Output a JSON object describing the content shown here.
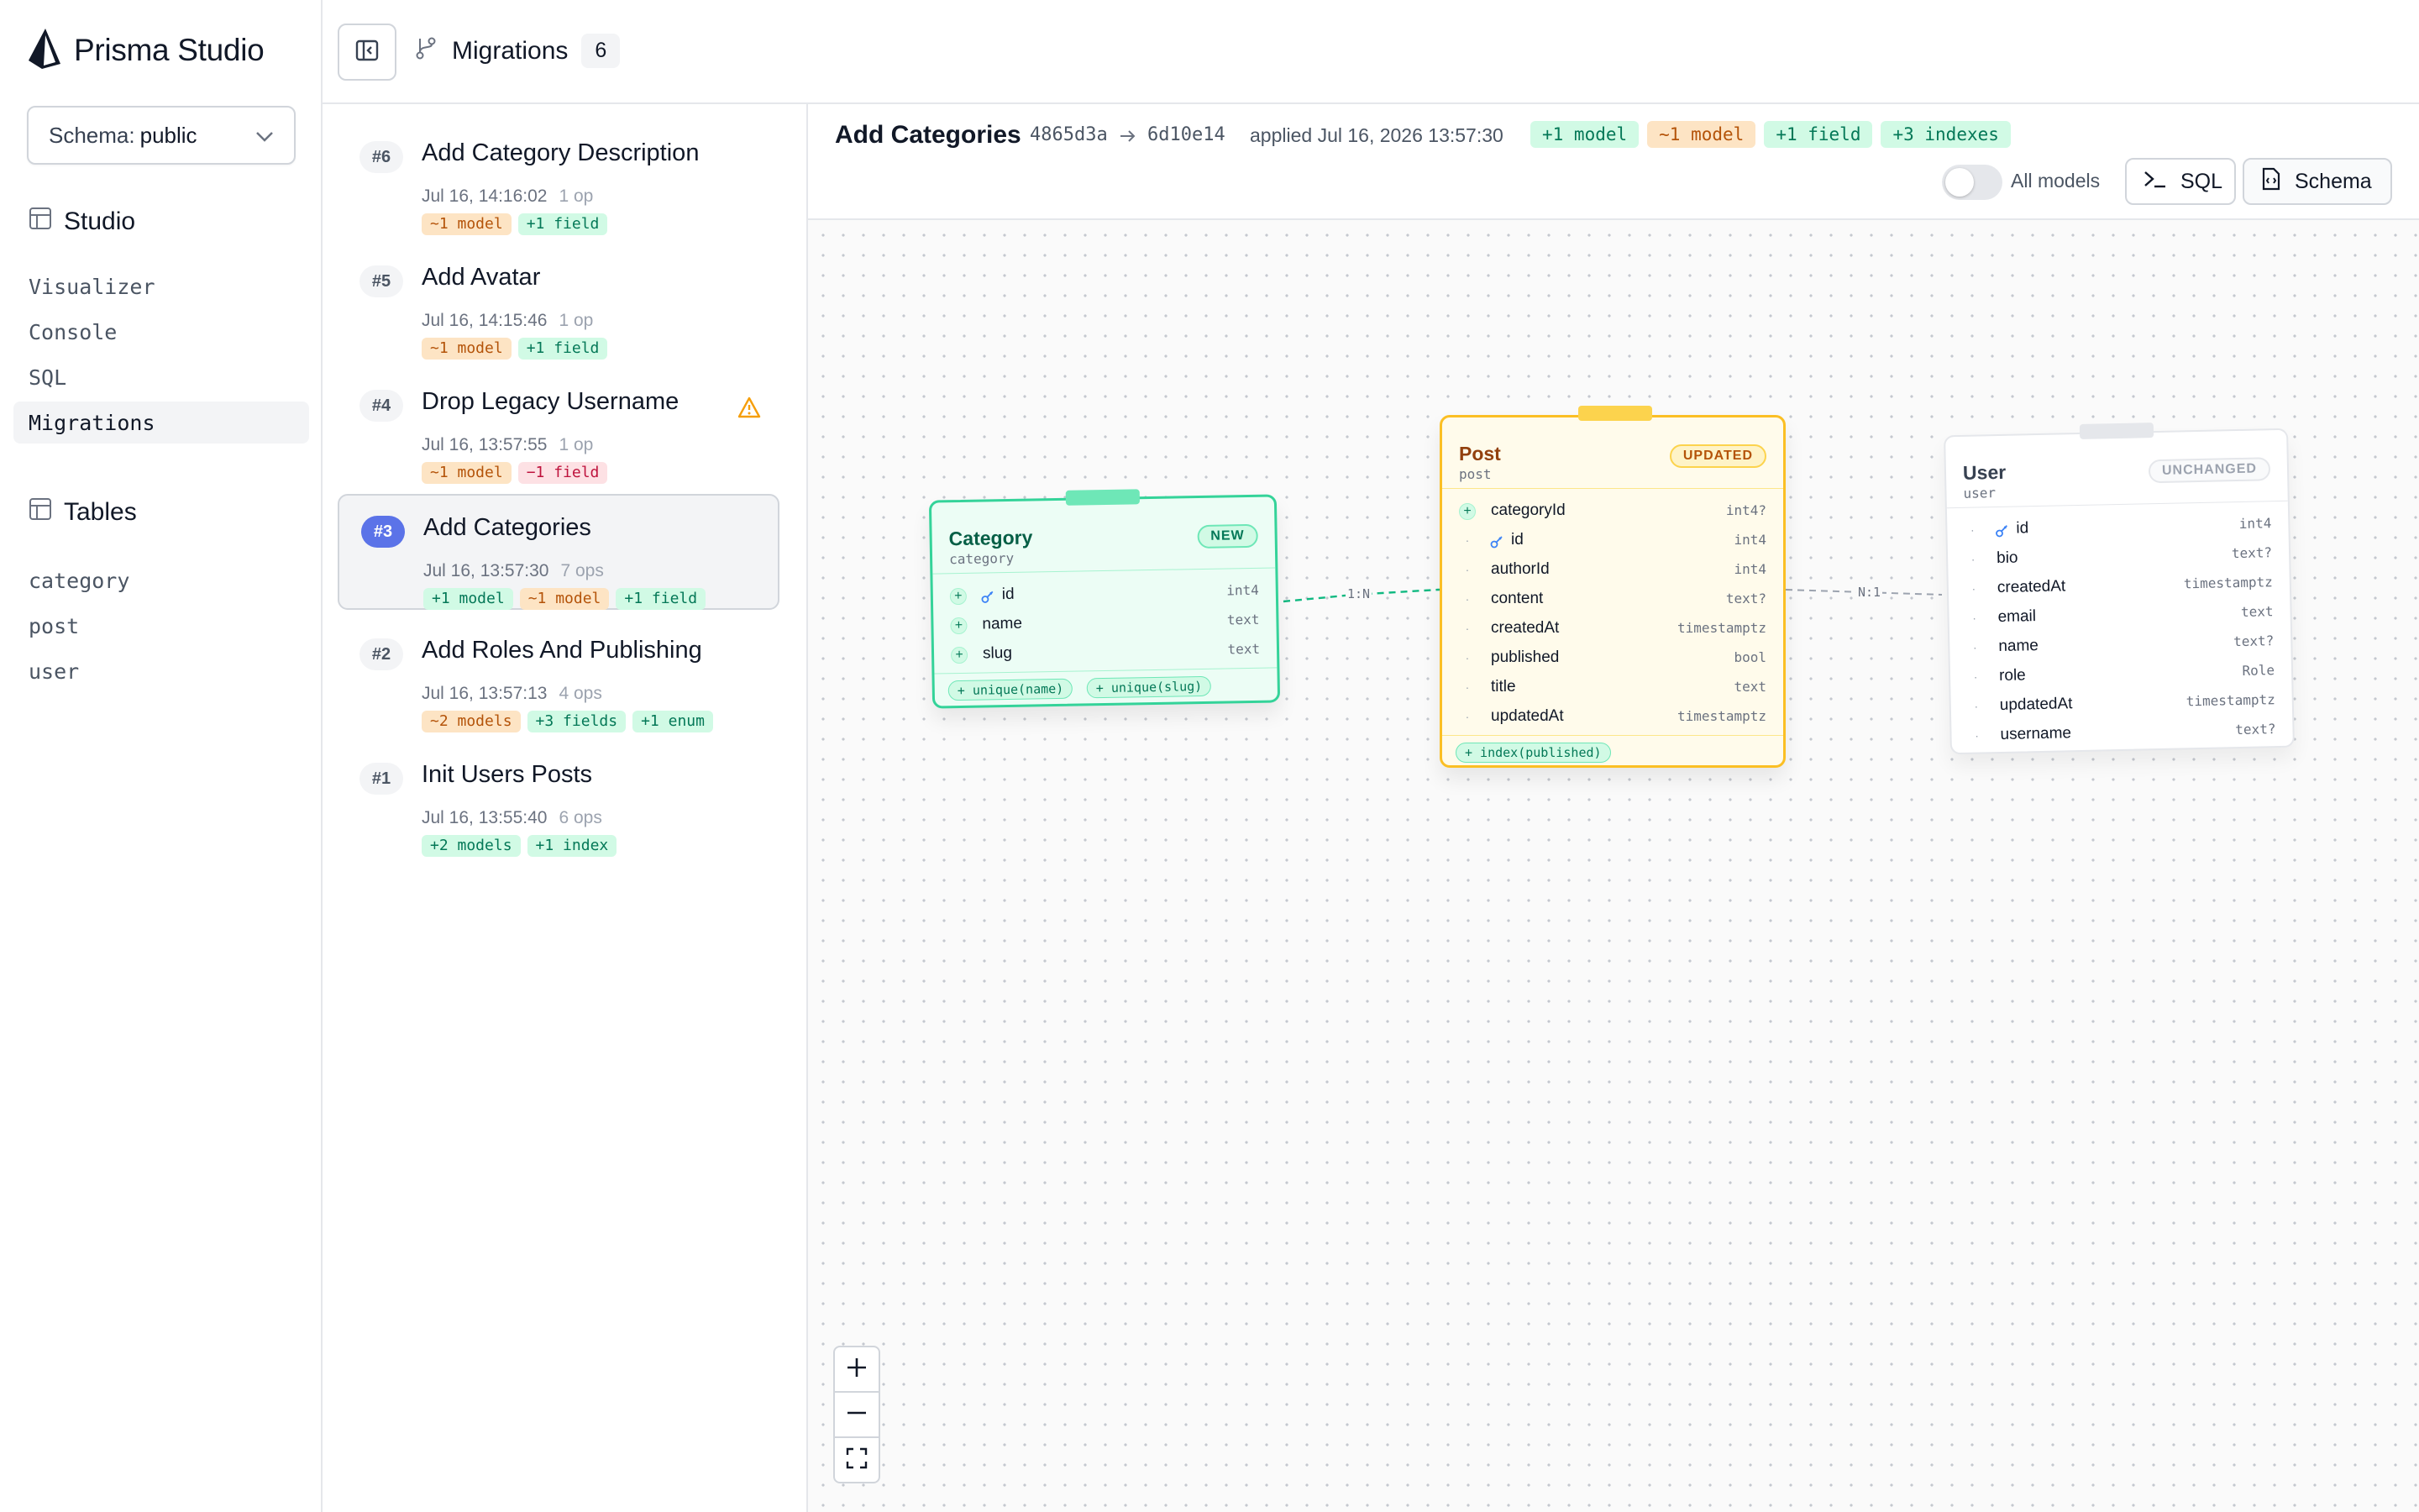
{
  "app": {
    "title": "Prisma Studio"
  },
  "schema": {
    "label": "Schema:",
    "value": "public"
  },
  "studio_section": {
    "title": "Studio",
    "items": [
      "Visualizer",
      "Console",
      "SQL",
      "Migrations"
    ],
    "active": "Migrations"
  },
  "tables_section": {
    "title": "Tables",
    "items": [
      "category",
      "post",
      "user"
    ]
  },
  "topbar": {
    "title": "Migrations",
    "count": "6"
  },
  "migrations": [
    {
      "num": "#6",
      "name": "Add Category Description",
      "time": "Jul 16, 14:16:02",
      "ops": "1 op",
      "tags": [
        {
          "t": "~1 model",
          "c": "orange"
        },
        {
          "t": "+1 field",
          "c": "green"
        }
      ],
      "warning": false,
      "active": false
    },
    {
      "num": "#5",
      "name": "Add Avatar",
      "time": "Jul 16, 14:15:46",
      "ops": "1 op",
      "tags": [
        {
          "t": "~1 model",
          "c": "orange"
        },
        {
          "t": "+1 field",
          "c": "green"
        }
      ],
      "warning": false,
      "active": false
    },
    {
      "num": "#4",
      "name": "Drop Legacy Username",
      "time": "Jul 16, 13:57:55",
      "ops": "1 op",
      "tags": [
        {
          "t": "~1 model",
          "c": "orange"
        },
        {
          "t": "−1 field",
          "c": "red"
        }
      ],
      "warning": true,
      "active": false
    },
    {
      "num": "#3",
      "name": "Add Categories",
      "time": "Jul 16, 13:57:30",
      "ops": "7 ops",
      "tags": [
        {
          "t": "+1 model",
          "c": "green"
        },
        {
          "t": "~1 model",
          "c": "orange"
        },
        {
          "t": "+1 field",
          "c": "green"
        }
      ],
      "warning": false,
      "active": true
    },
    {
      "num": "#2",
      "name": "Add Roles And Publishing",
      "time": "Jul 16, 13:57:13",
      "ops": "4 ops",
      "tags": [
        {
          "t": "~2 models",
          "c": "orange"
        },
        {
          "t": "+3 fields",
          "c": "green"
        },
        {
          "t": "+1 enum",
          "c": "green"
        }
      ],
      "warning": false,
      "active": false
    },
    {
      "num": "#1",
      "name": "Init Users Posts",
      "time": "Jul 16, 13:55:40",
      "ops": "6 ops",
      "tags": [
        {
          "t": "+2 models",
          "c": "green"
        },
        {
          "t": "+1 index",
          "c": "green"
        }
      ],
      "warning": false,
      "active": false
    }
  ],
  "detail": {
    "title": "Add Categories",
    "from_hash": "4865d3a",
    "to_hash": "6d10e14",
    "applied": "applied Jul 16, 2026 13:57:30",
    "tags": [
      {
        "t": "+1 model",
        "c": "green"
      },
      {
        "t": "~1 model",
        "c": "orange"
      },
      {
        "t": "+1 field",
        "c": "green"
      },
      {
        "t": "+3 indexes",
        "c": "green"
      }
    ],
    "all_models_label": "All models",
    "all_models_on": false,
    "sql_button": "SQL",
    "schema_button": "Schema"
  },
  "models": {
    "category": {
      "name": "Category",
      "table": "category",
      "status": "NEW",
      "fields": [
        {
          "name": "id",
          "type": "int4",
          "change": "add",
          "key": true
        },
        {
          "name": "name",
          "type": "text",
          "change": "add",
          "key": false
        },
        {
          "name": "slug",
          "type": "text",
          "change": "add",
          "key": false
        }
      ],
      "footer_tags": [
        "+ unique(name)",
        "+ unique(slug)"
      ]
    },
    "post": {
      "name": "Post",
      "table": "post",
      "status": "UPDATED",
      "fields": [
        {
          "name": "categoryId",
          "type": "int4?",
          "change": "add",
          "key": false
        },
        {
          "name": "id",
          "type": "int4",
          "change": "none",
          "key": true
        },
        {
          "name": "authorId",
          "type": "int4",
          "change": "none",
          "key": false
        },
        {
          "name": "content",
          "type": "text?",
          "change": "none",
          "key": false
        },
        {
          "name": "createdAt",
          "type": "timestamptz",
          "change": "none",
          "key": false
        },
        {
          "name": "published",
          "type": "bool",
          "change": "none",
          "key": false
        },
        {
          "name": "title",
          "type": "text",
          "change": "none",
          "key": false
        },
        {
          "name": "updatedAt",
          "type": "timestamptz",
          "change": "none",
          "key": false
        }
      ],
      "footer_tags": [
        "+ index(published)"
      ]
    },
    "user": {
      "name": "User",
      "table": "user",
      "status": "UNCHANGED",
      "fields": [
        {
          "name": "id",
          "type": "int4",
          "change": "none",
          "key": true
        },
        {
          "name": "bio",
          "type": "text?",
          "change": "none",
          "key": false
        },
        {
          "name": "createdAt",
          "type": "timestamptz",
          "change": "none",
          "key": false
        },
        {
          "name": "email",
          "type": "text",
          "change": "none",
          "key": false
        },
        {
          "name": "name",
          "type": "text?",
          "change": "none",
          "key": false
        },
        {
          "name": "role",
          "type": "Role",
          "change": "none",
          "key": false
        },
        {
          "name": "updatedAt",
          "type": "timestamptz",
          "change": "none",
          "key": false
        },
        {
          "name": "username",
          "type": "text?",
          "change": "none",
          "key": false
        }
      ],
      "footer_tags": []
    }
  },
  "relations": [
    {
      "from": "category",
      "to": "post",
      "label": "1:N"
    },
    {
      "from": "post",
      "to": "user",
      "label": "N:1"
    }
  ],
  "colors": {
    "new_border": "#34d399",
    "new_bg": "#ecfdf5",
    "new_text": "#065f46",
    "updated_border": "#fbbf24",
    "updated_bg": "#fffbeb",
    "updated_text": "#92400e",
    "unchanged_border": "#e5e7eb",
    "accent": "#5b73e8"
  }
}
